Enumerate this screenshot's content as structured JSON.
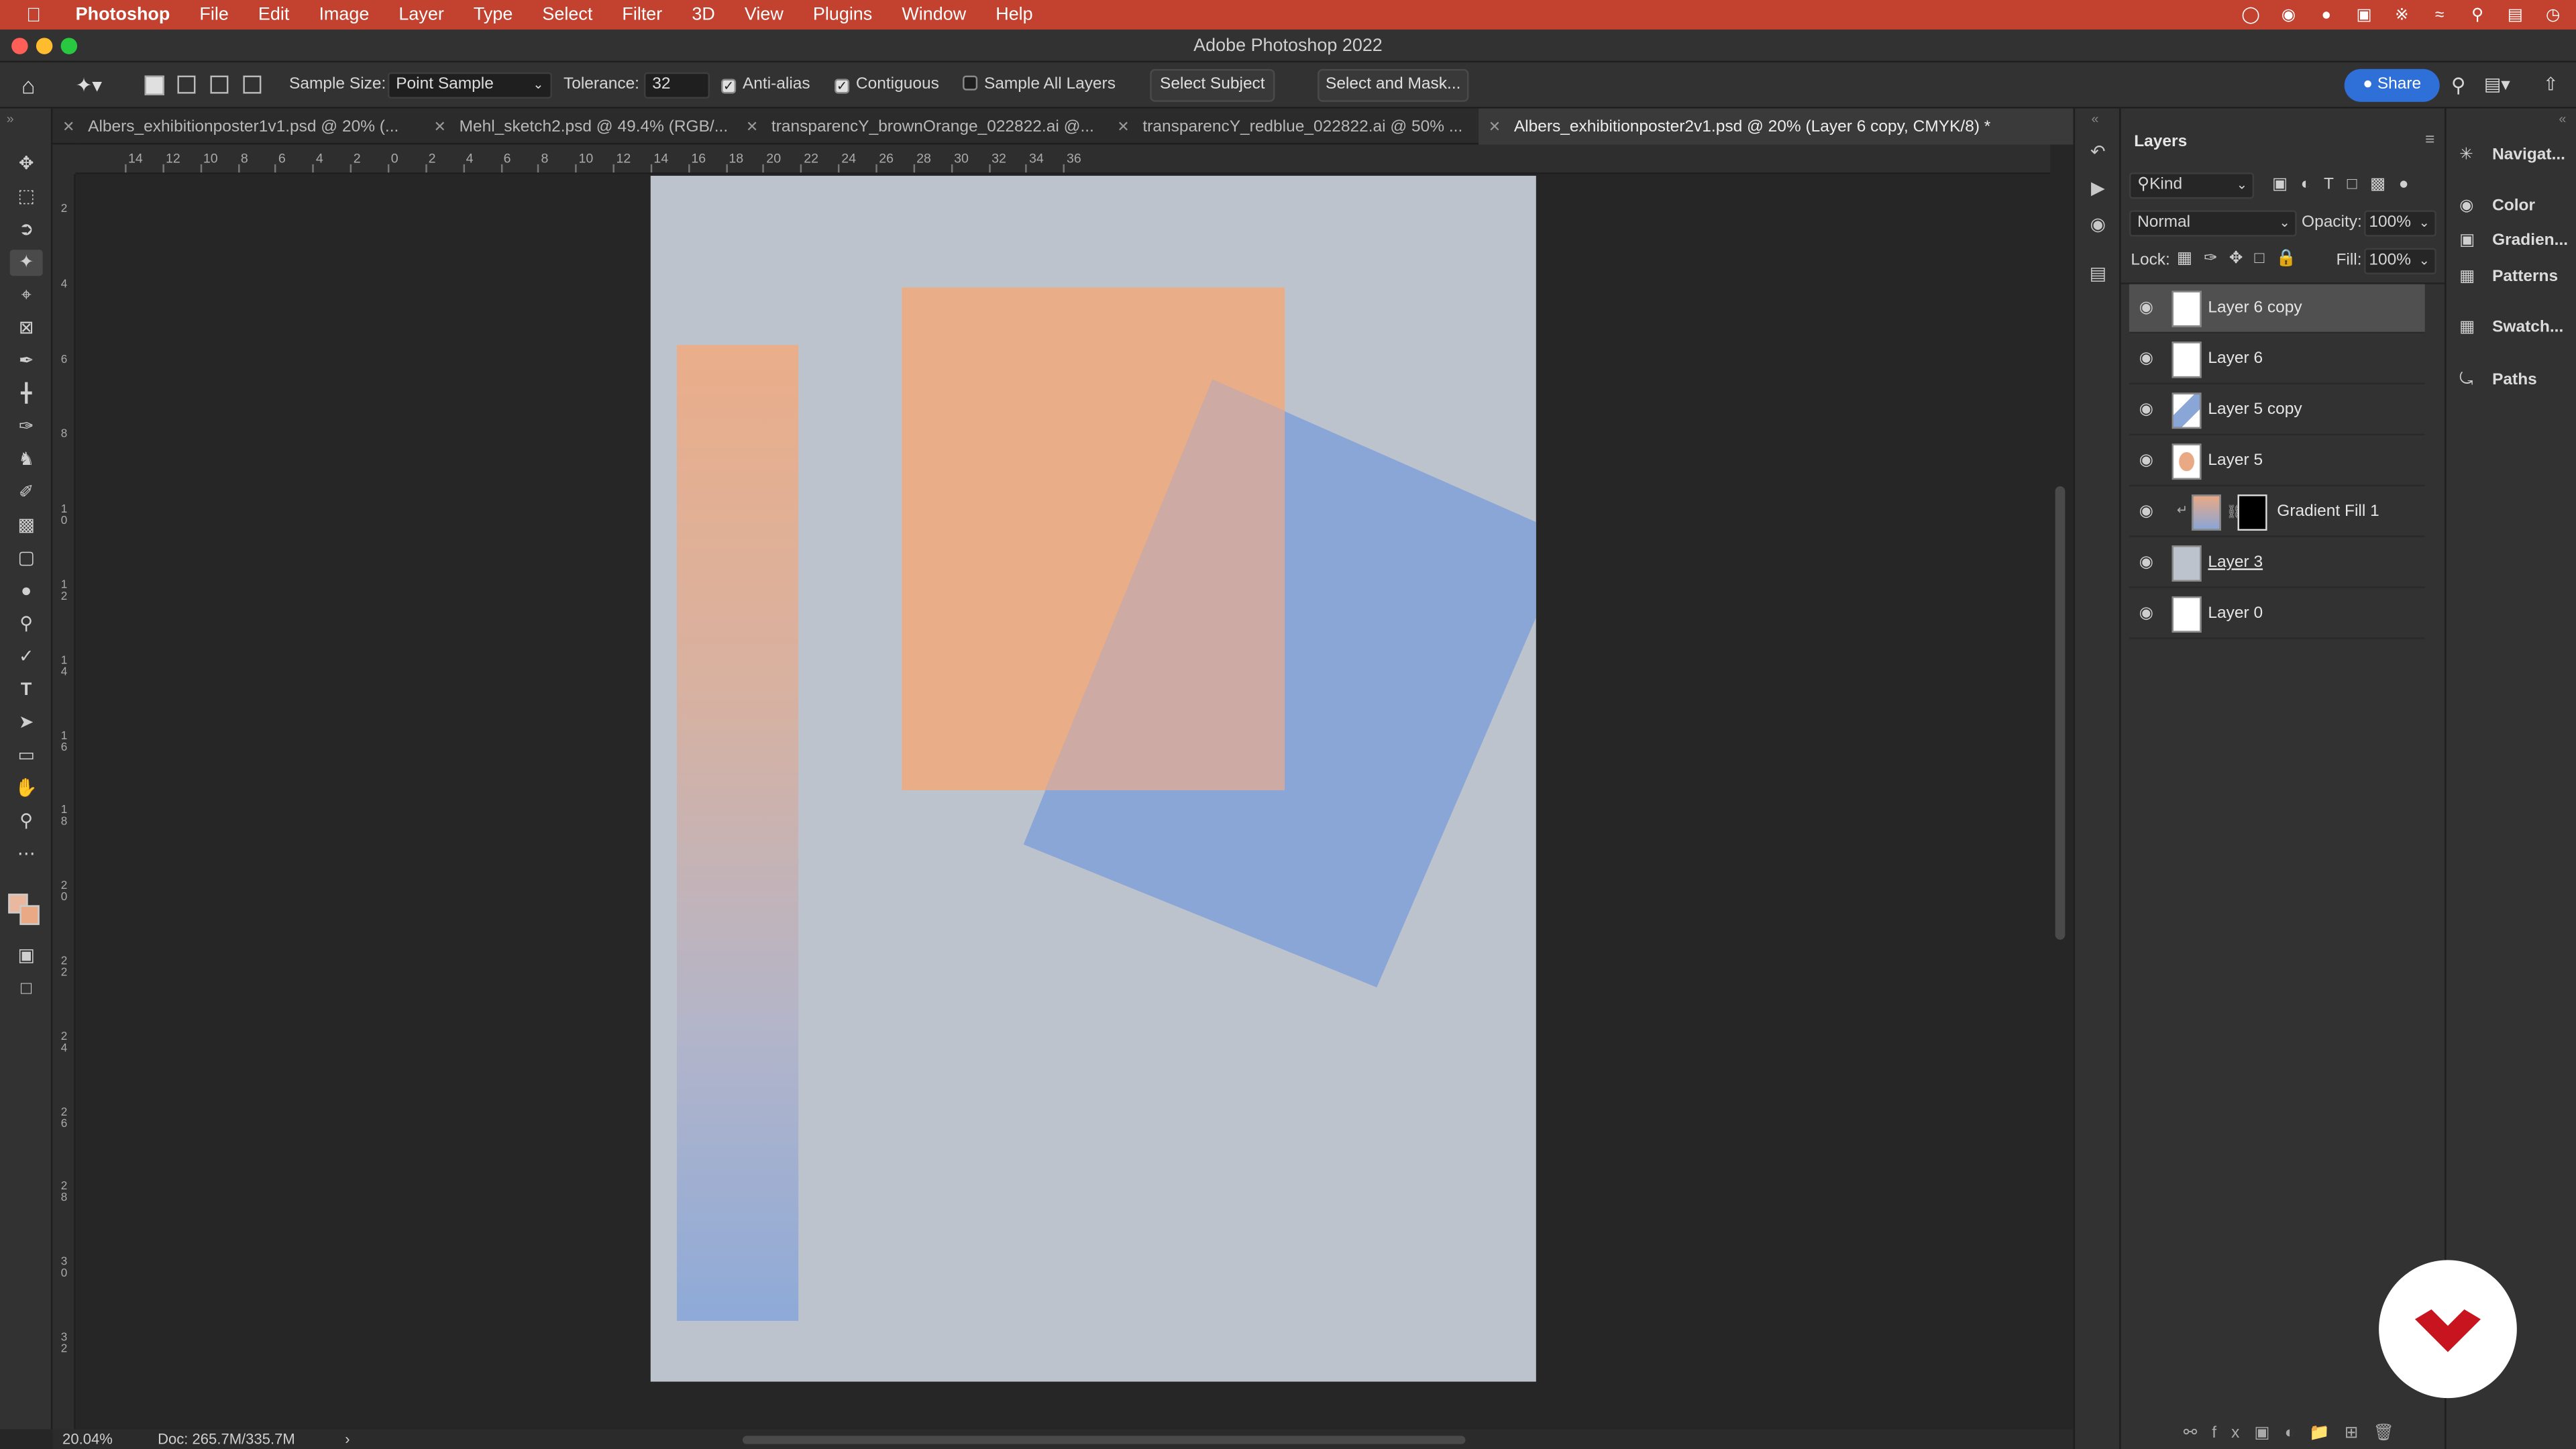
{
  "menubar": {
    "apple_icon": "apple-icon",
    "app": "Photoshop",
    "items": [
      "File",
      "Edit",
      "Image",
      "Layer",
      "Type",
      "Select",
      "Filter",
      "3D",
      "View",
      "Plugins",
      "Window",
      "Help"
    ],
    "status_icons": [
      "creative-cloud-icon",
      "cc-sync-icon",
      "notification-icon",
      "display-icon",
      "bluetooth-icon",
      "wifi-icon",
      "spotlight-icon",
      "control-center-icon",
      "clock-icon"
    ]
  },
  "window": {
    "title": "Adobe Photoshop 2022"
  },
  "options_bar": {
    "sample_size_label": "Sample Size:",
    "sample_size_value": "Point Sample",
    "tolerance_label": "Tolerance:",
    "tolerance_value": "32",
    "anti_alias": {
      "label": "Anti-alias",
      "checked": true
    },
    "contiguous": {
      "label": "Contiguous",
      "checked": true
    },
    "sample_all_layers": {
      "label": "Sample All Layers",
      "checked": false
    },
    "select_subject": "Select Subject",
    "select_and_mask": "Select and Mask...",
    "share": "Share"
  },
  "tabs": [
    {
      "label": "Albers_exhibitionposter1v1.psd @ 20% (..."
    },
    {
      "label": "Mehl_sketch2.psd @ 49.4% (RGB/..."
    },
    {
      "label": "transparencY_brownOrange_022822.ai @..."
    },
    {
      "label": "transparencY_redblue_022822.ai @ 50% ..."
    },
    {
      "label": "Albers_exhibitionposter2v1.psd @ 20% (Layer 6 copy, CMYK/8) *"
    }
  ],
  "ruler": {
    "h_labels": [
      "14",
      "12",
      "10",
      "8",
      "6",
      "4",
      "2",
      "0",
      "2",
      "4",
      "6",
      "8",
      "10",
      "12",
      "14",
      "16",
      "18",
      "20",
      "22",
      "24",
      "26",
      "28",
      "30",
      "32",
      "34",
      "36"
    ],
    "v_labels": [
      "2",
      "4",
      "6",
      "8",
      "1\n0",
      "1\n2",
      "1\n4",
      "1\n6",
      "1\n8",
      "2\n0",
      "2\n2",
      "2\n4",
      "2\n6",
      "2\n8",
      "3\n0",
      "3\n2"
    ]
  },
  "status": {
    "zoom": "20.04%",
    "doc": "Doc: 265.7M/335.7M",
    "arrow": "›"
  },
  "layers_panel": {
    "title": "Layers",
    "filter_kind": "Kind",
    "blend_mode": "Normal",
    "opacity_label": "Opacity:",
    "opacity_value": "100%",
    "lock_label": "Lock:",
    "fill_label": "Fill:",
    "fill_value": "100%",
    "layers": [
      {
        "name": "Layer 6 copy",
        "selected": true,
        "thumb": "#ffffff"
      },
      {
        "name": "Layer 6",
        "selected": false,
        "thumb": "#ffffff"
      },
      {
        "name": "Layer 5 copy",
        "selected": false,
        "thumb": "#8aa6d6"
      },
      {
        "name": "Layer 5",
        "selected": false,
        "thumb": "#e9a985"
      },
      {
        "name": "Gradient Fill 1",
        "selected": false,
        "thumb": "#9aaad0"
      },
      {
        "name": "Layer 3",
        "selected": false,
        "thumb": "#bdc3cd"
      },
      {
        "name": "Layer 0",
        "selected": false,
        "thumb": "#ffffff"
      }
    ]
  },
  "right_panels": [
    "Navigat...",
    "Color",
    "Gradien...",
    "Patterns",
    "Swatch...",
    "Paths"
  ],
  "colors": {
    "accent": "#2f6fd8",
    "menubar": "#c2412f",
    "orange": "#e9a985",
    "blue": "#8aa6d6",
    "doc_bg": "#bdc3cd"
  }
}
